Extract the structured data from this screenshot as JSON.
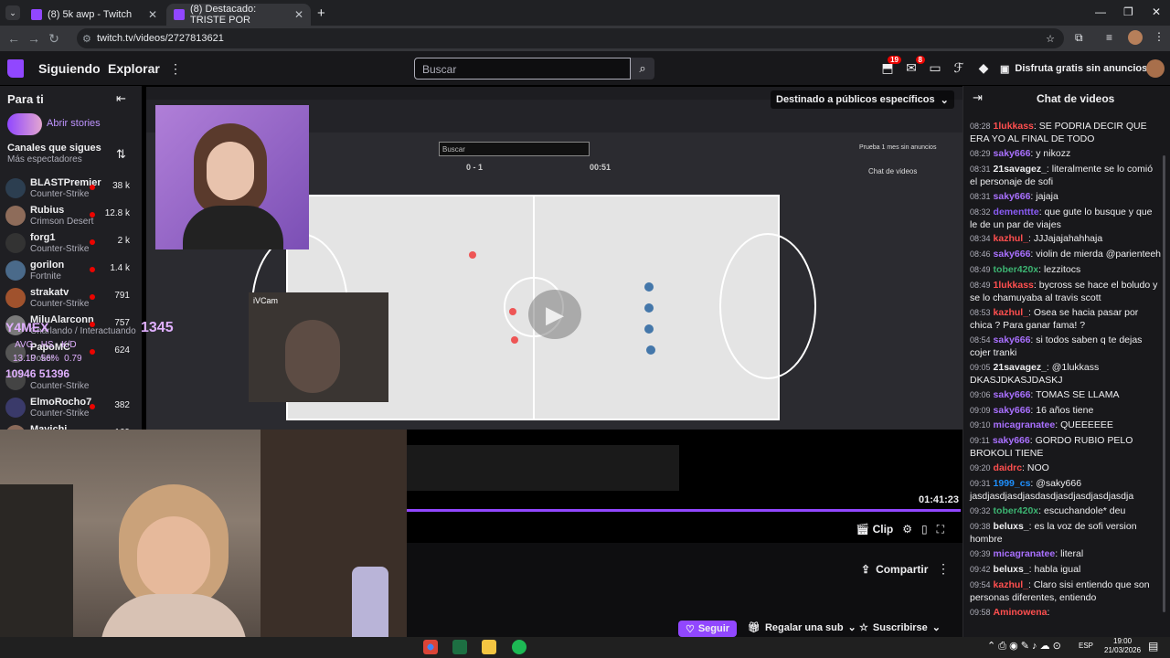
{
  "browser": {
    "tabs": [
      {
        "label": "(8) 5k awp - Twitch"
      },
      {
        "label": "(8) Destacado: TRISTE POR"
      }
    ],
    "url": "twitch.tv/videos/2727813621"
  },
  "topnav": {
    "following": "Siguiendo",
    "explore": "Explorar",
    "search_placeholder": "Buscar",
    "notif_count_1": "19",
    "notif_count_2": "8",
    "no_ads": "Disfruta gratis sin anuncios"
  },
  "sidebar": {
    "title": "Para ti",
    "stories": "Abrir stories",
    "followed": "Canales que sigues",
    "sort": "Más espectadores",
    "channels": [
      {
        "name": "BLASTPremier",
        "game": "Counter-Strike",
        "viewers": "38 k"
      },
      {
        "name": "Rubius",
        "game": "Crimson Desert",
        "viewers": "12.8 k"
      },
      {
        "name": "forg1",
        "game": "Counter-Strike",
        "viewers": "2 k"
      },
      {
        "name": "gorilon",
        "game": "Fortnite",
        "viewers": "1.4 k"
      },
      {
        "name": "strakatv",
        "game": "Counter-Strike",
        "viewers": "791"
      },
      {
        "name": "MiluAlarconn",
        "game": "Charlando / Interactuando",
        "viewers": "757"
      },
      {
        "name": "PapoMC",
        "game": "Poker",
        "viewers": "624"
      },
      {
        "name": "",
        "game": "Counter-Strike",
        "viewers": ""
      },
      {
        "name": "ElmoRocho7",
        "game": "Counter-Strike",
        "viewers": "382"
      },
      {
        "name": "Mavichi",
        "game": "",
        "viewers": "169"
      }
    ]
  },
  "video": {
    "banner": "Destinado a públicos específicos",
    "inner_search": "Buscar",
    "inner_score": "0 - 1",
    "inner_time": "00:51",
    "inner_chat_title": "Chat de videos",
    "inner_promo": "Prueba 1 mes sin anuncios",
    "ivcam": "iVCam",
    "timecode": "01:41:23",
    "clip": "Clip",
    "hud_name": "Y4MEX",
    "hud_1345": "1345",
    "hud_stats": "AVG   HS   K/D",
    "hud_vals": "13.19  56%  0.79",
    "hud_bottom": "10946 51396"
  },
  "below": {
    "share": "Compartir",
    "follow": "Seguir",
    "gift": "Regalar una sub",
    "subscribe": "Suscribirse"
  },
  "chat": {
    "title": "Chat de videos",
    "messages": [
      {
        "time": "08:28",
        "user": "1lukkass",
        "color": "#ff4f4f",
        "text": "SE PODRIA DECIR QUE ERA YO AL FINAL DE TODO"
      },
      {
        "time": "08:29",
        "user": "saky666",
        "color": "#a970ff",
        "text": "y nikozz"
      },
      {
        "time": "08:31",
        "user": "21savagez_",
        "color": "#efeff1",
        "text": "literalmente se lo comió el personaje de sofi"
      },
      {
        "time": "08:31",
        "user": "saky666",
        "color": "#a970ff",
        "text": "jajaja"
      },
      {
        "time": "08:32",
        "user": "dementtte",
        "color": "#8a5cf5",
        "text": "que gute lo busque y que le de un par de viajes"
      },
      {
        "time": "08:34",
        "user": "kazhul_",
        "color": "#ff4f4f",
        "text": "JJJajajahahhaja"
      },
      {
        "time": "08:46",
        "user": "saky666",
        "color": "#a970ff",
        "text": "violin de mierda @parienteeh"
      },
      {
        "time": "08:49",
        "user": "tober420x",
        "color": "#3cb371",
        "text": "lezzitocs"
      },
      {
        "time": "08:49",
        "user": "1lukkass",
        "color": "#ff4f4f",
        "text": "bycross se hace el boludo y se lo chamuyaba al travis scott"
      },
      {
        "time": "08:53",
        "user": "kazhul_",
        "color": "#ff4f4f",
        "text": "Osea se hacia pasar por chica ? Para ganar fama! ?"
      },
      {
        "time": "08:54",
        "user": "saky666",
        "color": "#a970ff",
        "text": "si todos saben q te dejas cojer tranki"
      },
      {
        "time": "09:05",
        "user": "21savagez_",
        "color": "#efeff1",
        "text": "@1lukkass DKASJDKASJDASKJ"
      },
      {
        "time": "09:06",
        "user": "saky666",
        "color": "#a970ff",
        "text": "TOMAS SE LLAMA"
      },
      {
        "time": "09:09",
        "user": "saky666",
        "color": "#a970ff",
        "text": "16 años tiene"
      },
      {
        "time": "09:10",
        "user": "micagranatee",
        "color": "#a970ff",
        "text": "QUEEEEEE"
      },
      {
        "time": "09:11",
        "user": "saky666",
        "color": "#a970ff",
        "text": "GORDO RUBIO PELO BROKOLI TIENE"
      },
      {
        "time": "09:20",
        "user": "daidrc",
        "color": "#ff4f4f",
        "text": "NOO"
      },
      {
        "time": "09:31",
        "user": "1999_cs",
        "color": "#1e90ff",
        "text": "@saky666 jasdjasdjasdjasdasdjasdjasdjasdjasdja"
      },
      {
        "time": "09:32",
        "user": "tober420x",
        "color": "#3cb371",
        "text": "escuchandole* deu"
      },
      {
        "time": "09:38",
        "user": "beluxs_",
        "color": "#efeff1",
        "text": "es la voz de sofi version hombre"
      },
      {
        "time": "09:39",
        "user": "micagranatee",
        "color": "#a970ff",
        "text": "literal"
      },
      {
        "time": "09:42",
        "user": "beluxs_",
        "color": "#efeff1",
        "text": "habla igual"
      },
      {
        "time": "09:54",
        "user": "kazhul_",
        "color": "#ff4f4f",
        "text": "Claro sisi entiendo que son personas diferentes, entiendo"
      },
      {
        "time": "09:58",
        "user": "Aminowena",
        "color": "#ff4f4f",
        "text": ""
      }
    ]
  },
  "taskbar": {
    "lang": "ESP",
    "time": "19:00",
    "date": "21/03/2026"
  },
  "colors": {
    "accent": "#9147ff",
    "live": "#eb0400",
    "bg": "#0e0e10"
  }
}
